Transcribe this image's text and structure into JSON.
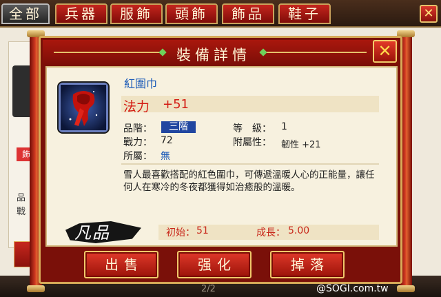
{
  "top_tabs": [
    "全部",
    "兵器",
    "服飾",
    "頭飾",
    "飾品",
    "鞋子"
  ],
  "background": {
    "left_tag": "飾",
    "left_lines": [
      "品",
      "戰"
    ],
    "page_indicator": "2/2",
    "close_symbol": "✕"
  },
  "watermark": "@SOGI.com.tw",
  "dialog": {
    "title": "裝備詳情",
    "close_symbol": "✕",
    "item": {
      "name": "紅圍巾",
      "primary_stat_label": "法力",
      "primary_stat_value": "+51",
      "grade_label": "品階：",
      "grade_value": "三階",
      "level_label": "等　級：",
      "level_value": "1",
      "power_label": "戰力：",
      "power_value": "72",
      "attached_label": "附屬性：",
      "attached_value": "韌性 +21",
      "faction_label": "所屬：",
      "faction_value": "無",
      "description": "雪人最喜歡搭配的紅色圍巾，可傳遞溫暖人心的正能量，讓任何人在寒冷的冬夜都獲得如治癒般的溫暖。",
      "rarity": "凡品",
      "initial_label": "初始：",
      "initial_value": "51",
      "growth_label": "成長：",
      "growth_value": "5.00"
    },
    "buttons": {
      "sell": "出售",
      "enhance": "强化",
      "drop": "掉落"
    }
  },
  "colors": {
    "accent_red": "#c8281b",
    "gold_border": "#d7aa58",
    "item_name_blue": "#1c5bb8",
    "grade_badge": "#2146a0"
  },
  "icons": {
    "item": "red-scarf-icon",
    "close": "close-icon"
  }
}
